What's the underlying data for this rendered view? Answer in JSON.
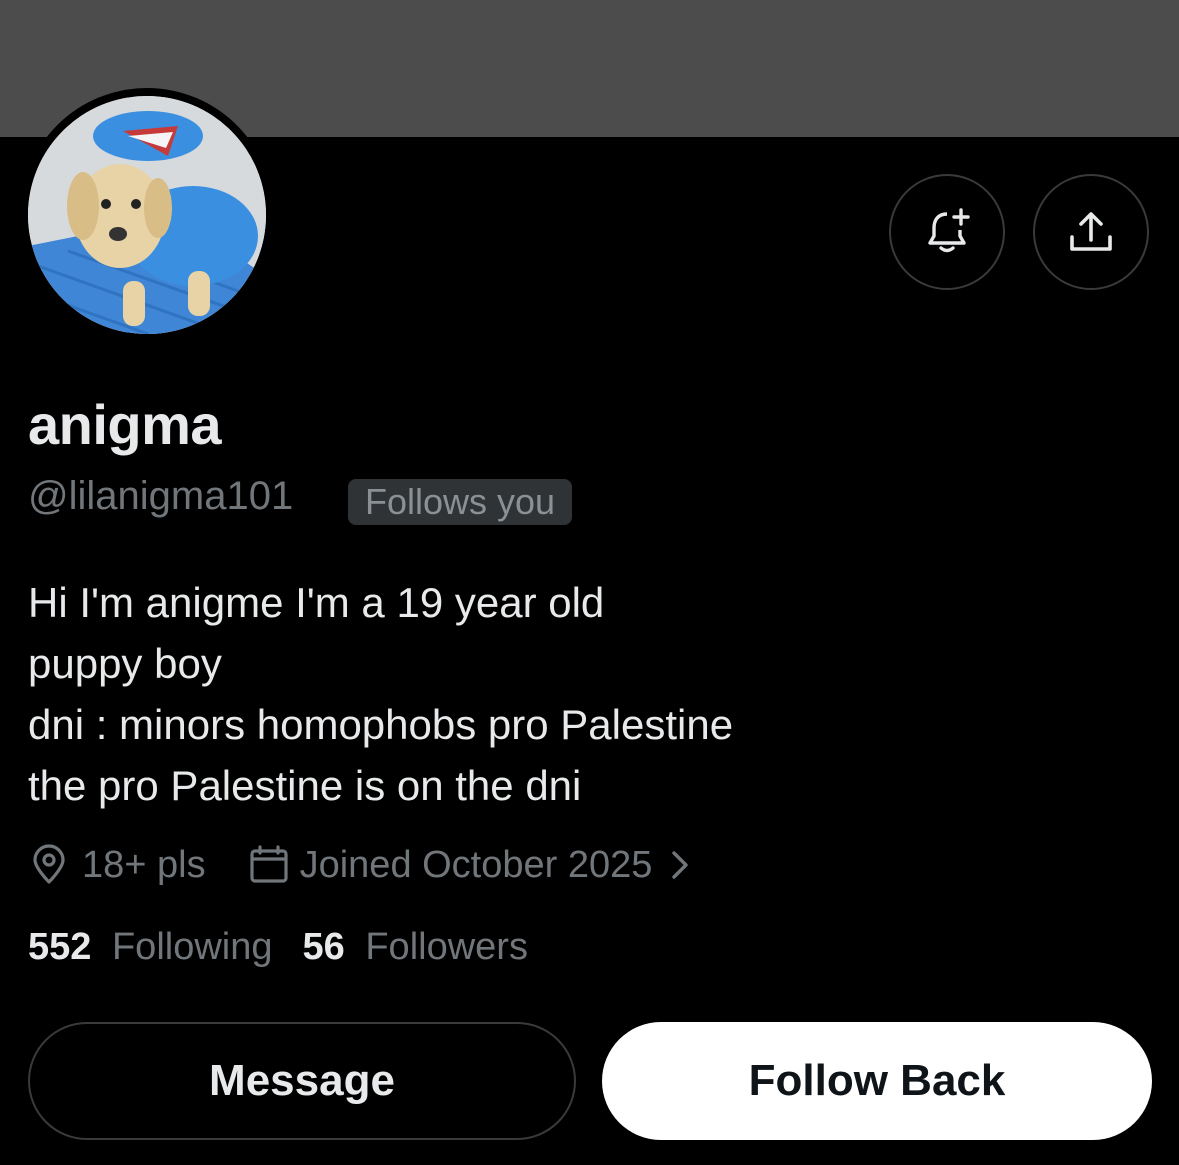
{
  "profile": {
    "display_name": "anigma",
    "handle": "@lilanigma101",
    "follows_badge": "Follows you",
    "bio_lines": [
      "Hi I'm anigme I'm a 19 year old",
      "puppy boy",
      "dni : minors homophobs pro Palestine",
      "the pro Palestine is on the dni"
    ],
    "location": "18+ pls",
    "joined": "Joined October 2025",
    "following_count": "552",
    "following_label": "Following",
    "followers_count": "56",
    "followers_label": "Followers"
  },
  "actions": {
    "message_label": "Message",
    "follow_back_label": "Follow Back"
  },
  "icons": {
    "notify": "bell-plus-icon",
    "share": "share-icon",
    "location": "location-pin-icon",
    "calendar": "calendar-icon",
    "chevron": "chevron-right-icon"
  },
  "colors": {
    "banner": "#4c4c4c",
    "background": "#000000",
    "muted_text": "#71767b",
    "primary_text": "#e7e9ea"
  }
}
